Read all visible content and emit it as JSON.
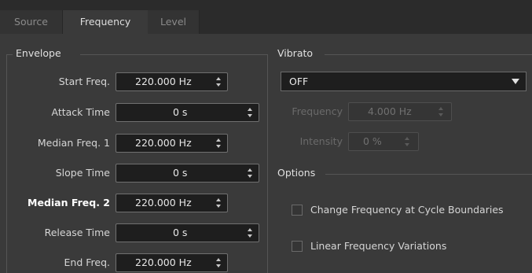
{
  "tabs": [
    {
      "label": "Source",
      "active": false
    },
    {
      "label": "Frequency",
      "active": true
    },
    {
      "label": "Level",
      "active": false
    }
  ],
  "envelope": {
    "title": "Envelope",
    "rows": [
      {
        "label": "Start Freq.",
        "value": "220.000 Hz",
        "bold": false
      },
      {
        "label": "Attack Time",
        "value": "0 s",
        "bold": false
      },
      {
        "label": "Median Freq. 1",
        "value": "220.000 Hz",
        "bold": false
      },
      {
        "label": "Slope Time",
        "value": "0 s",
        "bold": false
      },
      {
        "label": "Median Freq. 2",
        "value": "220.000 Hz",
        "bold": true
      },
      {
        "label": "Release Time",
        "value": "0 s",
        "bold": false
      },
      {
        "label": "End Freq.",
        "value": "220.000 Hz",
        "bold": false
      }
    ]
  },
  "vibrato": {
    "title": "Vibrato",
    "mode": "OFF",
    "frequency_label": "Frequency",
    "frequency_value": "4.000 Hz",
    "intensity_label": "Intensity",
    "intensity_value": "0 %"
  },
  "options": {
    "title": "Options",
    "items": [
      {
        "label": "Change Frequency at Cycle Boundaries",
        "checked": false
      },
      {
        "label": "Linear Frequency Variations",
        "checked": false
      }
    ]
  },
  "colors": {
    "background": "#2b2b2b",
    "panel": "#3a3a3a",
    "field": "#1e1e1e",
    "text": "#d6d6d6"
  }
}
